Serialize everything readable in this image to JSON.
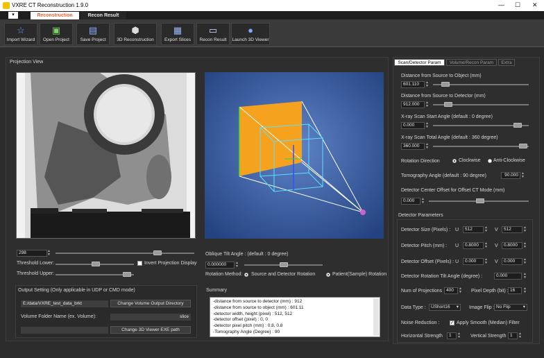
{
  "window": {
    "title": "VXRE CT Reconstruction 1.9.0",
    "minimize": "—",
    "maximize": "☐",
    "close": "✕"
  },
  "tabs": [
    {
      "label": "Reconstruction"
    },
    {
      "label": "Recon Result"
    }
  ],
  "toolbar": [
    {
      "label": "Import Wizard",
      "icon": "☆"
    },
    {
      "label": "Open Project",
      "icon": "▣"
    },
    {
      "label": "Save Project",
      "icon": "▤"
    },
    {
      "label": "3D Reconstruction",
      "icon": "⬢"
    },
    {
      "label": "Export Slices",
      "icon": "▦"
    },
    {
      "label": "Recon Result",
      "icon": "▭"
    },
    {
      "label": "Launch 3D Viewer",
      "icon": "●"
    }
  ],
  "projection": {
    "title": "Projection View",
    "index": "298",
    "threshold_lower_label": "Threshold Lower:",
    "threshold_upper_label": "Threshold Upper:",
    "invert_label": "Invert Projection Display"
  },
  "oblique": {
    "label": "Oblique Tilt Angle : (default : 0 degree)",
    "value": "0.000000",
    "rotation_method_label": "Rotation Method:",
    "opt1": "Source and Detector Rotation",
    "opt2": "Patient(Sample) Rotation"
  },
  "output": {
    "title": "Output Setting (Only applicable in UDP or CMD mode)",
    "path": "E:/data/VXRE_test_data_brkt",
    "change_dir": "Change Volume Output Directory",
    "folder_label": "Volume Folder Name (ex. Volume):",
    "folder_value": "slice",
    "change_exe": "Change 3D Viewer EXE path"
  },
  "summary": {
    "title": "Summary",
    "lines": [
      "-distance from source to detector (mm) : 912",
      "-distance from source to object (mm) : 601.11",
      "-detector width, height (pixel) : 512, 512",
      "-detector offset (pixel) : 0, 0",
      "-detector pixel pitch (mm) : 0.8, 0.8",
      "-Tomography Angle (Degree) : 90"
    ]
  },
  "right_tabs": [
    {
      "label": "Scan/Detector Param"
    },
    {
      "label": "Volume/Recon Param"
    },
    {
      "label": "Extra"
    }
  ],
  "scan": {
    "src_obj_label": "Distance from Source to Object (mm)",
    "src_obj": "601.110",
    "src_det_label": "Distance from Source to Detector (mm)",
    "src_det": "912.000",
    "start_label": "X-ray Scan Start Angle (default : 0 degree)",
    "start": "0.000",
    "total_label": "X-ray Scan Total Angle (default : 360 degree)",
    "total": "360.000",
    "rot_dir_label": "Rotation Direction",
    "cw": "Clockwise",
    "ccw": "Anti-Clockwise",
    "tomo_label": "Tomography Angle (default : 90 degree)",
    "tomo": "90.000",
    "offset_label": "Detector Center Offset for Offset CT Mode (mm)",
    "offset": "0.000"
  },
  "detector": {
    "title": "Detector Parameters",
    "size_label": "Detector Size (Pixels) :",
    "u": "U",
    "v": "V",
    "size_u": "512",
    "size_v": "512",
    "pitch_label": "Detector Pitch (mm) :",
    "pitch_u": "0.8000",
    "pitch_v": "0.8000",
    "offset_label": "Detector Offset (Pixels) :",
    "offset_u": "0.000",
    "offset_v": "0.000",
    "tilt_label": "Detector Rotation Tilt Angle (degree) :",
    "tilt": "0.000",
    "nproj_label": "Num of Projections",
    "nproj": "400",
    "depth_label": "Pixel Depth (bit) :",
    "depth": "16",
    "dtype_label": "Data Type :",
    "dtype": "UShort16",
    "flip_label": "Image Flip :",
    "flip": "No Flip",
    "noise_label": "Noise Reduction :",
    "noise_opt": "Apply Smooth (Median) Filter",
    "hstr_label": "Horizontal Strength",
    "hstr": "1",
    "vstr_label": "Vertical Strength",
    "vstr": "1"
  },
  "colors": {
    "accent": "#e8623c",
    "tab_active_bg": "#ffffff",
    "view3d_bg": "#2f5aa8",
    "detector_plate": "#f5a21f"
  }
}
